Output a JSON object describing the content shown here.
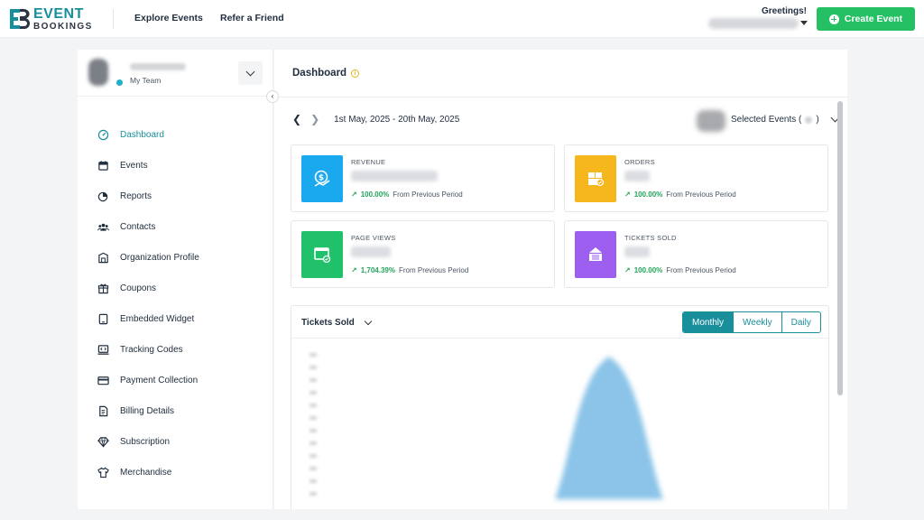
{
  "header": {
    "logo_line1": "EVENT",
    "logo_line2": "BOOKINGS",
    "nav": [
      {
        "label": "Explore Events"
      },
      {
        "label": "Refer a Friend"
      }
    ],
    "greeting": "Greetings!",
    "create_label": "Create Event"
  },
  "sidebar": {
    "team_label": "My Team",
    "items": [
      {
        "label": "Dashboard",
        "icon": "gauge-icon",
        "active": true
      },
      {
        "label": "Events",
        "icon": "calendar-icon"
      },
      {
        "label": "Reports",
        "icon": "pie-chart-icon"
      },
      {
        "label": "Contacts",
        "icon": "users-icon"
      },
      {
        "label": "Organization Profile",
        "icon": "building-icon"
      },
      {
        "label": "Coupons",
        "icon": "gift-icon"
      },
      {
        "label": "Embedded Widget",
        "icon": "tablet-icon"
      },
      {
        "label": "Tracking Codes",
        "icon": "code-window-icon"
      },
      {
        "label": "Payment Collection",
        "icon": "credit-card-icon"
      },
      {
        "label": "Billing Details",
        "icon": "invoice-icon"
      },
      {
        "label": "Subscription",
        "icon": "diamond-icon"
      },
      {
        "label": "Merchandise",
        "icon": "tshirt-icon"
      }
    ]
  },
  "main": {
    "title": "Dashboard",
    "date_range": "1st May, 2025 - 20th May, 2025",
    "selected_events_label": "Selected Events (",
    "selected_events_close": ")",
    "cards": [
      {
        "label": "REVENUE",
        "change": "100.00%",
        "change_text": "From Previous Period",
        "color": "#1aa8ef",
        "icon": "money-icon"
      },
      {
        "label": "ORDERS",
        "change": "100.00%",
        "change_text": "From Previous Period",
        "color": "#f5b71c",
        "icon": "boxes-icon"
      },
      {
        "label": "PAGE VIEWS",
        "change": "1,704.39%",
        "change_text": "From Previous Period",
        "color": "#21c16b",
        "icon": "browser-icon"
      },
      {
        "label": "TICKETS SOLD",
        "change": "100.00%",
        "change_text": "From Previous Period",
        "color": "#9d5ff0",
        "icon": "ticket-icon"
      }
    ],
    "chart": {
      "title": "Tickets Sold",
      "periods": [
        "Monthly",
        "Weekly",
        "Daily"
      ],
      "active_period": "Monthly"
    }
  },
  "colors": {
    "brand": "#1a8f9c",
    "create_button": "#24c063",
    "trend_up": "#23a55a",
    "chart_fill": "#8bc4e8"
  }
}
